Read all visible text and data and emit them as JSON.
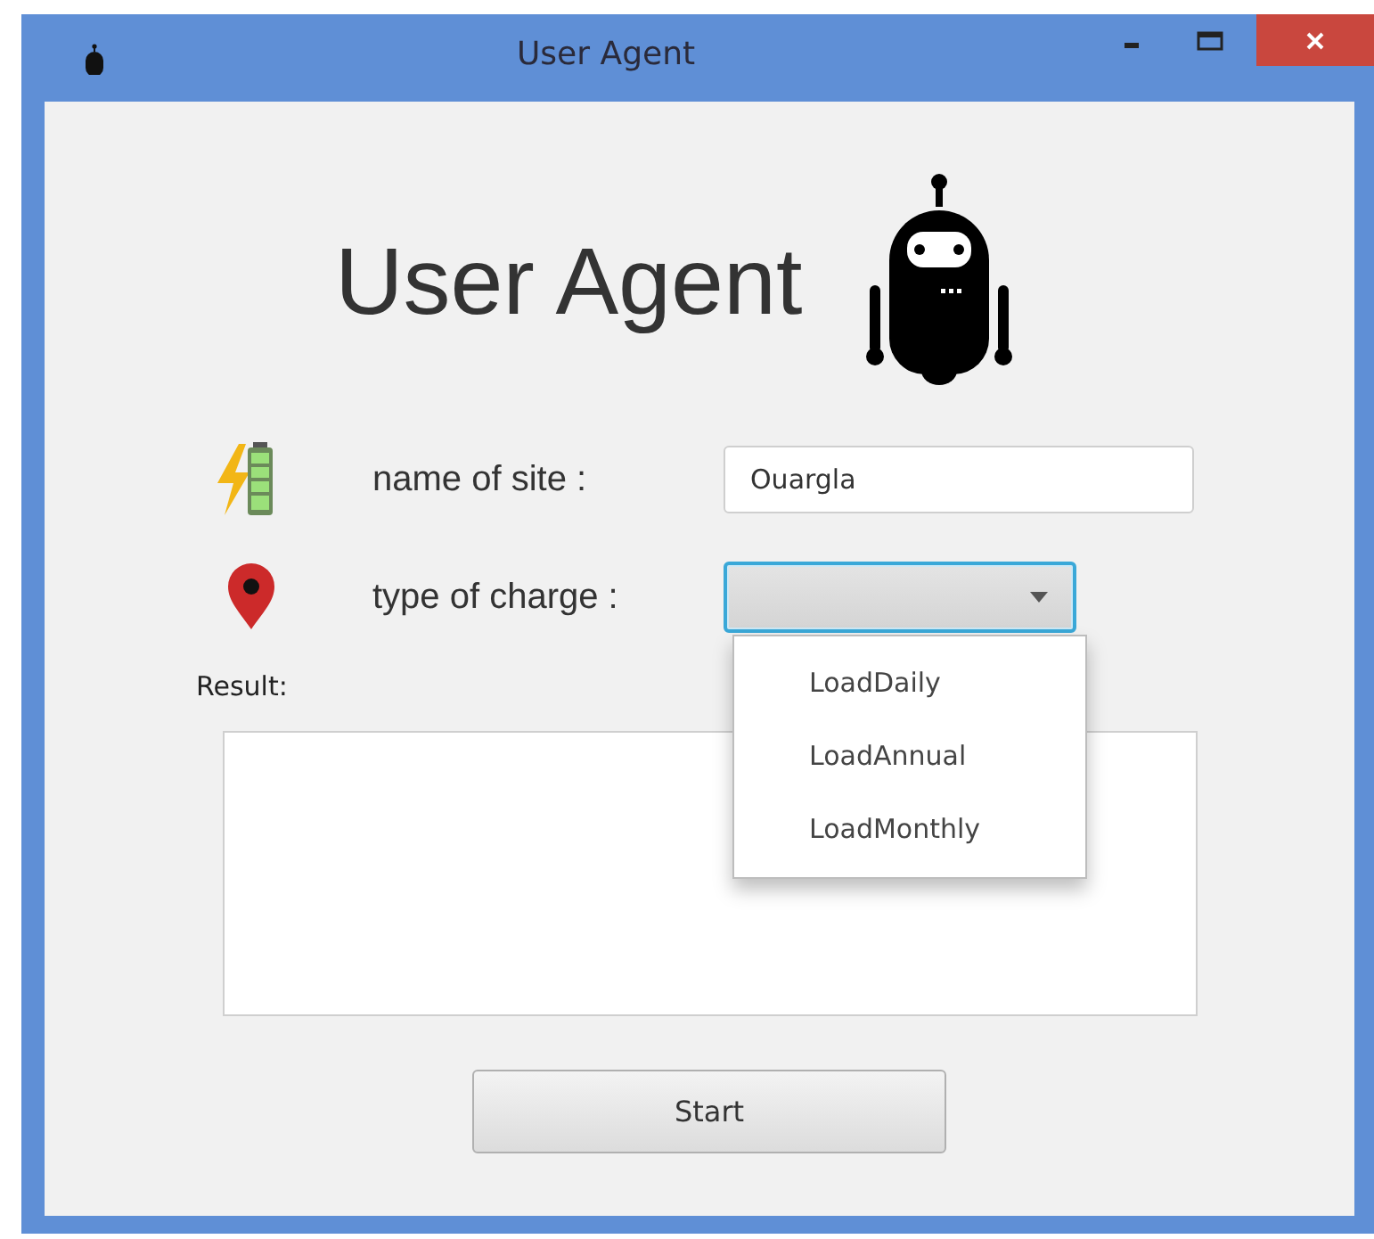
{
  "window": {
    "title": "User Agent"
  },
  "heading": "User Agent",
  "fields": [
    {
      "kind": "text",
      "label": "name of site :",
      "value": "Ouargla"
    },
    {
      "kind": "combo",
      "label": "type of charge :",
      "expanded": true,
      "options": [
        {
          "label": "LoadDaily",
          "selected": false
        },
        {
          "label": "LoadAnnual",
          "selected": false
        },
        {
          "label": "LoadMonthly",
          "selected": false
        }
      ]
    }
  ],
  "result": {
    "label": "Result:"
  },
  "buttons": [
    "Start"
  ]
}
